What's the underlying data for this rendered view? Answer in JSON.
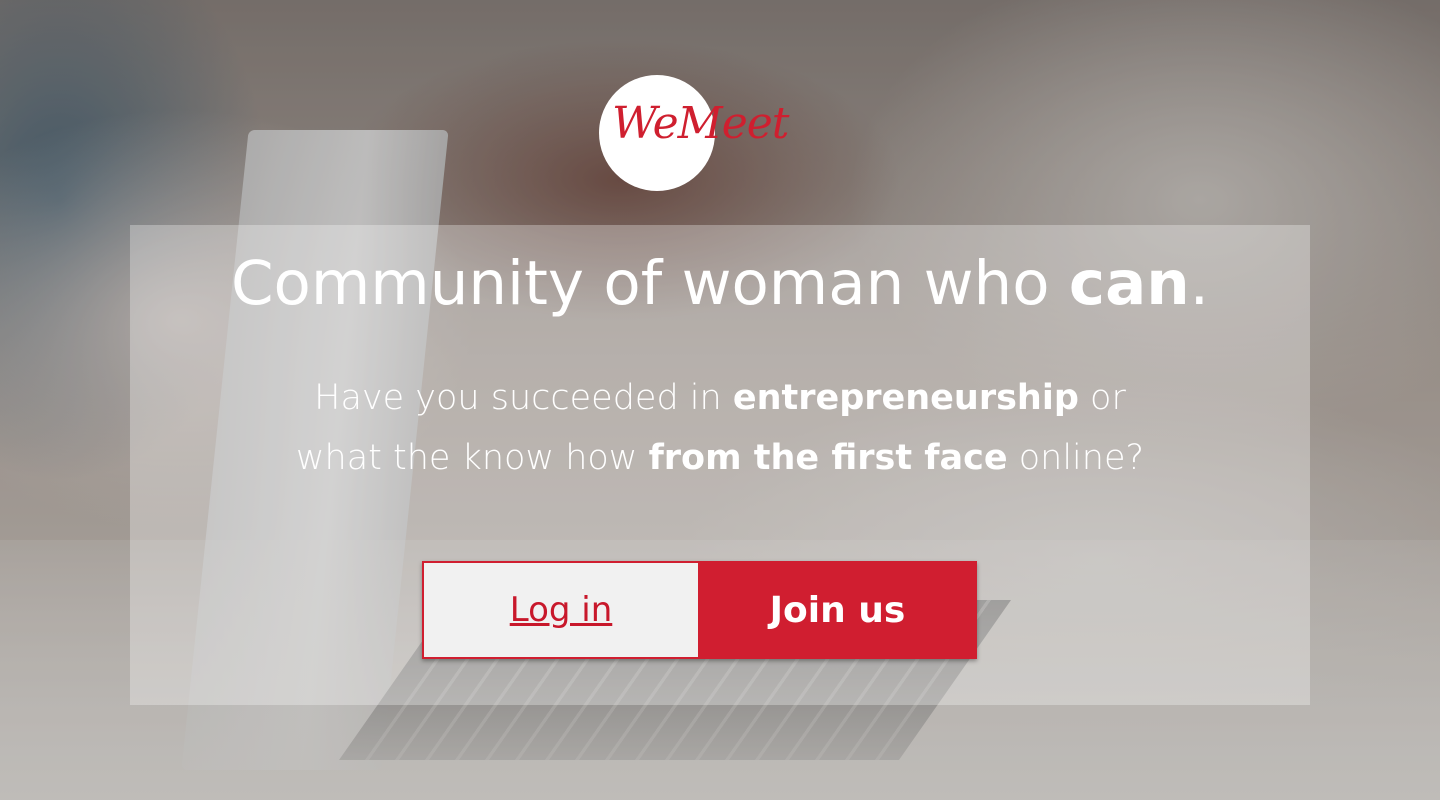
{
  "brand": {
    "logo_text": "WeMeet",
    "accent_color": "#d01e30"
  },
  "hero": {
    "headline_part1": "Community of woman who ",
    "headline_strong": "can",
    "headline_end": ".",
    "subtitle_line1_a": "Have you succeeded in ",
    "subtitle_line1_b": "entrepreneurship",
    "subtitle_line1_c": " or",
    "subtitle_line2_a": "what the know how ",
    "subtitle_line2_b": "from the first face",
    "subtitle_line2_c": " online?"
  },
  "actions": {
    "login_label": "Log in",
    "join_label": "Join us"
  }
}
